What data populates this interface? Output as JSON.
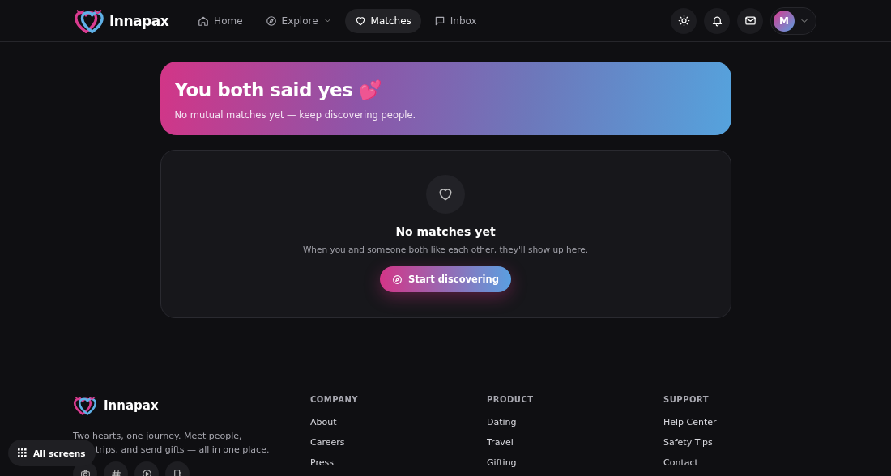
{
  "header": {
    "brand": "Innapax",
    "nav": [
      {
        "label": "Home",
        "selected": false,
        "dropdown": false
      },
      {
        "label": "Explore",
        "selected": false,
        "dropdown": true
      },
      {
        "label": "Matches",
        "selected": true,
        "dropdown": false
      },
      {
        "label": "Inbox",
        "selected": false,
        "dropdown": false
      }
    ],
    "avatar": "M"
  },
  "banner": {
    "title": "You both said yes",
    "emoji": "💕",
    "subtitle": "No mutual matches yet — keep discovering people."
  },
  "empty_state": {
    "title": "No matches yet",
    "message": "When you and someone both like each other, they'll show up here.",
    "button": "Start discovering"
  },
  "footer": {
    "brand": "Innapax",
    "tagline_lines": [
      "Two hearts, one journey. Meet people,",
      "trips, and send gifts — all in one place."
    ],
    "columns": [
      {
        "heading": "COMPANY",
        "links": [
          "About",
          "Careers",
          "Press"
        ]
      },
      {
        "heading": "PRODUCT",
        "links": [
          "Dating",
          "Travel",
          "Gifting"
        ]
      },
      {
        "heading": "SUPPORT",
        "links": [
          "Help Center",
          "Safety Tips",
          "Contact"
        ]
      }
    ]
  },
  "overlay_button": "All screens"
}
